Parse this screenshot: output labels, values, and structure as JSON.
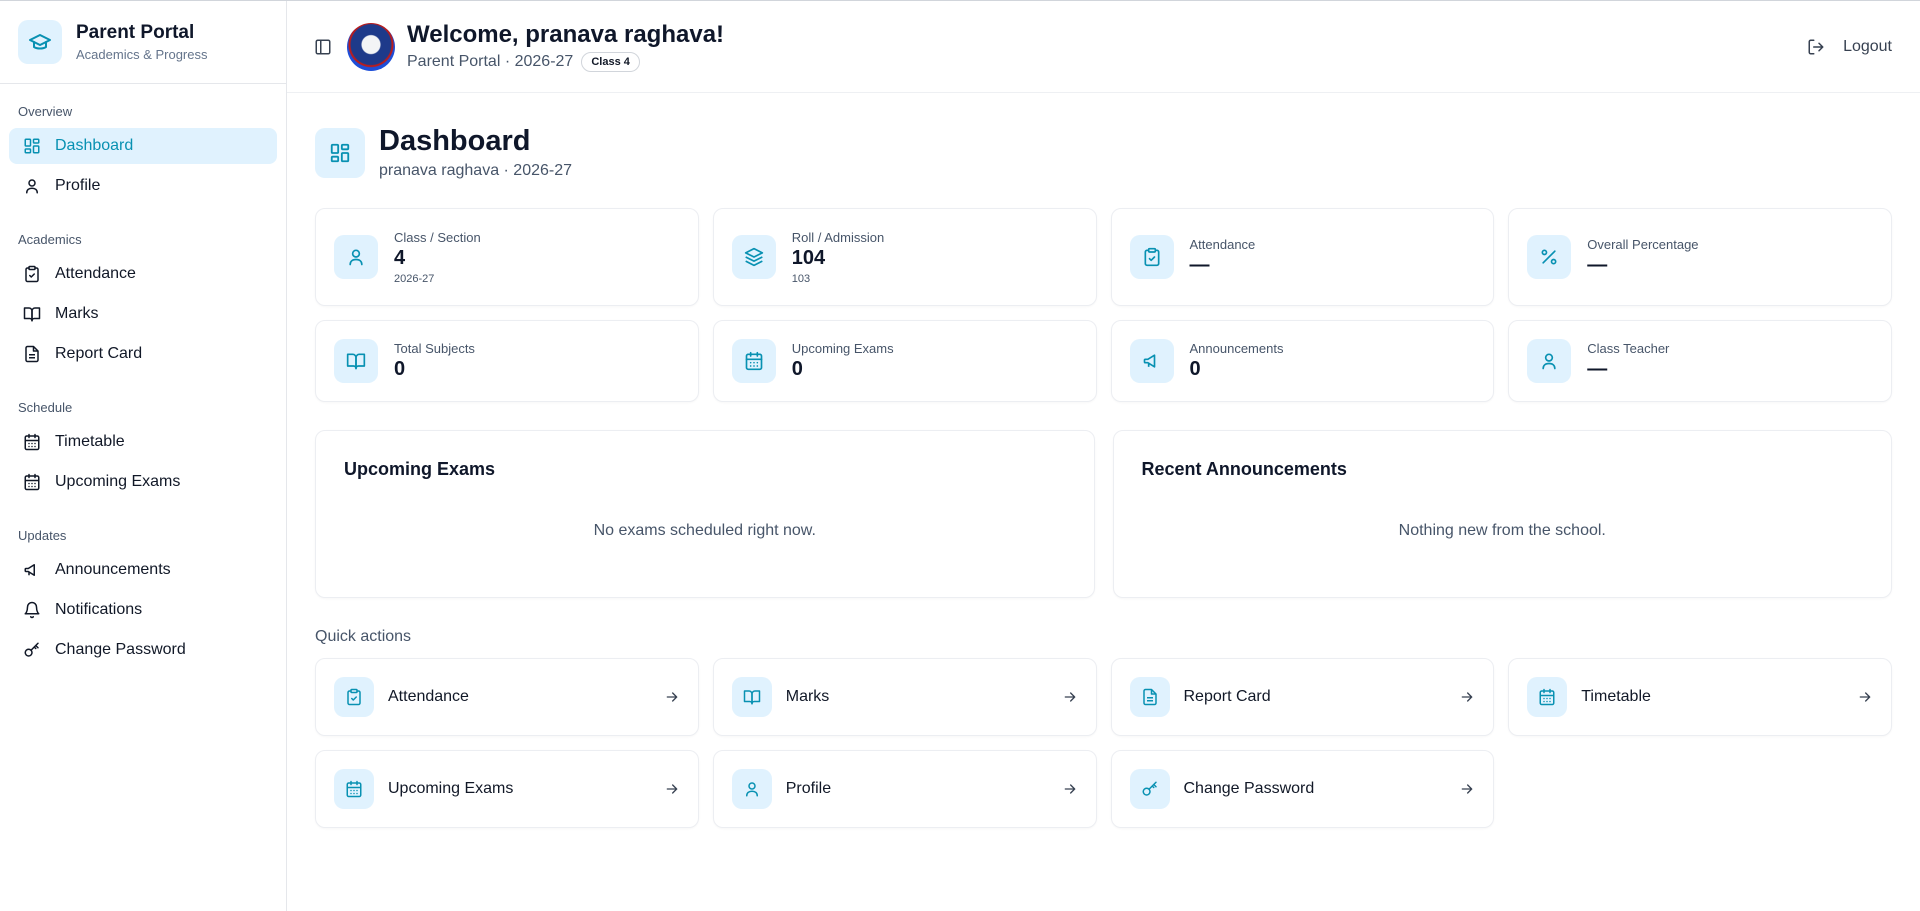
{
  "brand": {
    "title": "Parent Portal",
    "subtitle": "Academics & Progress"
  },
  "accent": "#0891b2",
  "sidebar": {
    "groups": [
      {
        "label": "Overview",
        "items": [
          {
            "label": "Dashboard",
            "icon": "dashboard-icon",
            "active": true
          },
          {
            "label": "Profile",
            "icon": "user-icon"
          }
        ]
      },
      {
        "label": "Academics",
        "items": [
          {
            "label": "Attendance",
            "icon": "clipboard-check-icon"
          },
          {
            "label": "Marks",
            "icon": "book-open-icon"
          },
          {
            "label": "Report Card",
            "icon": "file-text-icon"
          }
        ]
      },
      {
        "label": "Schedule",
        "items": [
          {
            "label": "Timetable",
            "icon": "calendar-icon"
          },
          {
            "label": "Upcoming Exams",
            "icon": "calendar-icon"
          }
        ]
      },
      {
        "label": "Updates",
        "items": [
          {
            "label": "Announcements",
            "icon": "megaphone-icon"
          },
          {
            "label": "Notifications",
            "icon": "bell-icon"
          },
          {
            "label": "Change Password",
            "icon": "key-icon"
          }
        ]
      }
    ]
  },
  "header": {
    "welcome": "Welcome, pranava raghava!",
    "subtitle": "Parent Portal · 2026-27",
    "class_badge": "Class 4",
    "logout": "Logout"
  },
  "page": {
    "title": "Dashboard",
    "subtitle": "pranava raghava · 2026-27"
  },
  "stats": {
    "class_section": {
      "label": "Class / Section",
      "value": "4",
      "note": "2026-27"
    },
    "roll_admission": {
      "label": "Roll / Admission",
      "value": "104",
      "note": "103"
    },
    "attendance": {
      "label": "Attendance",
      "value": "—"
    },
    "overall_percentage": {
      "label": "Overall Percentage",
      "value": "—"
    },
    "total_subjects": {
      "label": "Total Subjects",
      "value": "0"
    },
    "upcoming_exams": {
      "label": "Upcoming Exams",
      "value": "0"
    },
    "announcements": {
      "label": "Announcements",
      "value": "0"
    },
    "class_teacher": {
      "label": "Class Teacher",
      "value": "—"
    }
  },
  "panels": {
    "upcoming_exams": {
      "title": "Upcoming Exams",
      "empty": "No exams scheduled right now."
    },
    "recent_announcements": {
      "title": "Recent Announcements",
      "empty": "Nothing new from the school."
    }
  },
  "quick_actions": {
    "label": "Quick actions",
    "items": [
      {
        "label": "Attendance",
        "icon": "clipboard-check-icon"
      },
      {
        "label": "Marks",
        "icon": "book-open-icon"
      },
      {
        "label": "Report Card",
        "icon": "file-text-icon"
      },
      {
        "label": "Timetable",
        "icon": "calendar-icon"
      },
      {
        "label": "Upcoming Exams",
        "icon": "calendar-icon"
      },
      {
        "label": "Profile",
        "icon": "user-icon"
      },
      {
        "label": "Change Password",
        "icon": "key-icon"
      }
    ]
  }
}
